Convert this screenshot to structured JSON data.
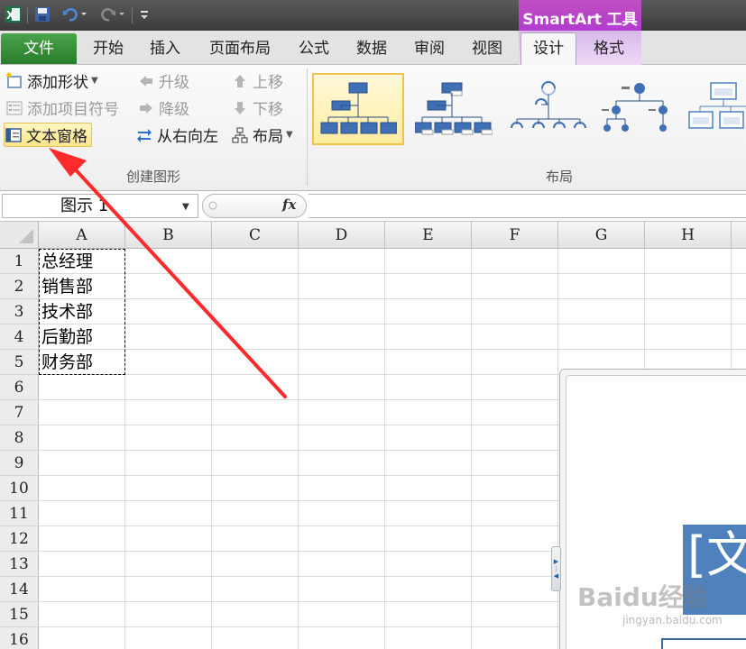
{
  "quick_access": {
    "excel_icon": "excel-icon",
    "save_icon": "save-icon",
    "undo_icon": "undo-icon",
    "redo_icon": "redo-icon",
    "customize_icon": "customize-icon"
  },
  "contextual_tab": {
    "label": "SmartArt 工具"
  },
  "tabs": {
    "file": "文件",
    "home": "开始",
    "insert": "插入",
    "page_layout": "页面布局",
    "formulas": "公式",
    "data": "数据",
    "review": "审阅",
    "view": "视图",
    "design": "设计",
    "format": "格式"
  },
  "ribbon": {
    "create_graphic": {
      "add_shape": "添加形状",
      "add_bullet": "添加项目符号",
      "text_pane": "文本窗格",
      "promote": "升级",
      "demote": "降级",
      "right_to_left": "从右向左",
      "move_up": "上移",
      "move_down": "下移",
      "layout": "布局",
      "group_label": "创建图形"
    },
    "layouts": {
      "group_label": "布局"
    }
  },
  "formula_bar": {
    "name_box": "图示 1",
    "fx": "fx",
    "value": ""
  },
  "sheet": {
    "columns": [
      "A",
      "B",
      "C",
      "D",
      "E",
      "F",
      "G",
      "H"
    ],
    "rows": [
      "1",
      "2",
      "3",
      "4",
      "5",
      "6",
      "7",
      "8",
      "9",
      "10",
      "11",
      "12",
      "13",
      "14",
      "15",
      "16"
    ],
    "cells_a": [
      "总经理",
      "销售部",
      "技术部",
      "后勤部",
      "财务部"
    ]
  },
  "smartart": {
    "box_text": "[文"
  },
  "watermark": {
    "brand": "Baidu经验",
    "url": "jingyan.baidu.com"
  },
  "colors": {
    "file_tab": "#2a7c2b",
    "contextual": "#b03ad0",
    "smartart_fill": "#4f81bd",
    "annotation_arrow": "#ff2a2a"
  }
}
